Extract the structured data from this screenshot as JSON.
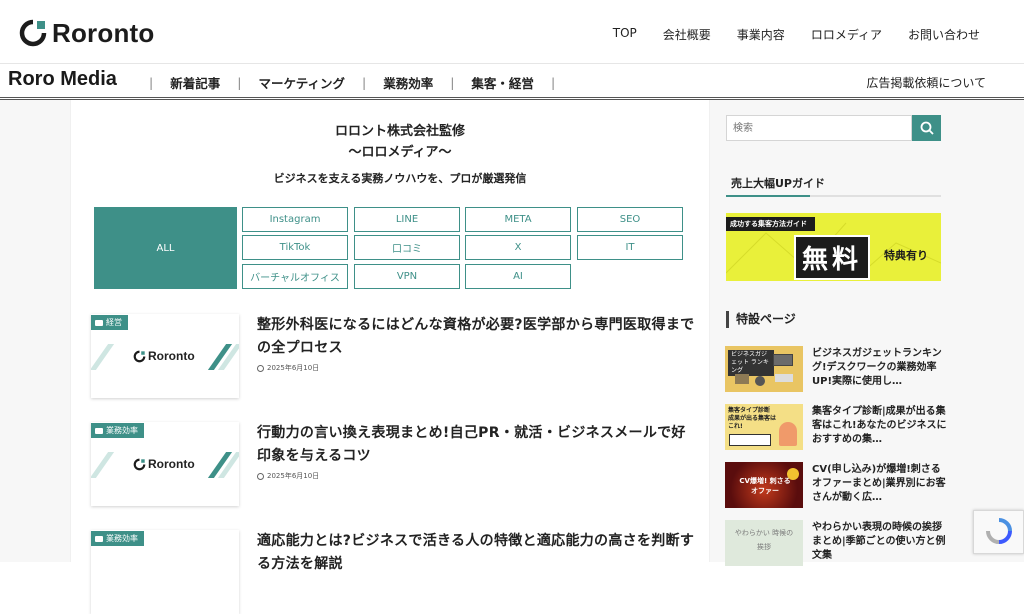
{
  "header": {
    "logo_text": "Roronto",
    "nav": [
      "TOP",
      "会社概要",
      "事業内容",
      "ロロメディア",
      "お問い合わせ"
    ]
  },
  "catbar": {
    "brand": "Roro Media",
    "categories": [
      "新着記事",
      "マーケティング",
      "業務効率",
      "集客・経営"
    ],
    "separator": "|",
    "ad_link": "広告掲載依頼について"
  },
  "hero": {
    "line1": "ロロント株式会社監修",
    "line2": "〜ロロメディア〜",
    "tagline": "ビジネスを支える実務ノウハウを、プロが厳選発信"
  },
  "filters": {
    "all": "ALL",
    "chips": [
      "Instagram",
      "LINE",
      "META",
      "SEO",
      "TikTok",
      "口コミ",
      "X",
      "IT",
      "バーチャルオフィス",
      "VPN",
      "AI"
    ]
  },
  "articles": [
    {
      "tag": "経営",
      "title": "整形外科医になるにはどんな資格が必要?医学部から専門医取得までの全プロセス",
      "date": "2025年6月10日",
      "thumb_logo": "Roronto"
    },
    {
      "tag": "業務効率",
      "title": "行動力の言い換え表現まとめ!自己PR・就活・ビジネスメールで好印象を与えるコツ",
      "date": "2025年6月10日",
      "thumb_logo": "Roronto"
    },
    {
      "tag": "業務効率",
      "title": "適応能力とは?ビジネスで活きる人の特徴と適応能力の高さを判断する方法を解説",
      "date": "",
      "thumb_logo": ""
    }
  ],
  "sidebar": {
    "search_placeholder": "検索",
    "guide_heading": "売上大幅UPガイド",
    "banner": {
      "tab": "成功する集客方法ガイド",
      "free": "無料",
      "bonus": "特典有り"
    },
    "special_heading": "特設ページ",
    "items": [
      {
        "title": "ビジネスガジェットランキング!デスクワークの業務効率UP!実際に使用し…",
        "thumb_text": "ビジネスガジェット ランキング"
      },
      {
        "title": "集客タイプ診断|成果が出る集客はこれ!あなたのビジネスにおすすめの集…",
        "thumb_text": "集客タイプ診断 成果が出る集客はこれ!"
      },
      {
        "title": "CV(申し込み)が爆増!刺さるオファーまとめ|業界別にお客さんが動く広…",
        "thumb_text": "CV爆増! 刺さるオファー"
      },
      {
        "title": "やわらかい表現の時候の挨拶まとめ|季節ごとの使い方と例文集",
        "thumb_text": "やわらかい 時候の挨拶"
      }
    ]
  },
  "colors": {
    "accent": "#3e9088",
    "banner_yellow": "#e9f03a"
  }
}
